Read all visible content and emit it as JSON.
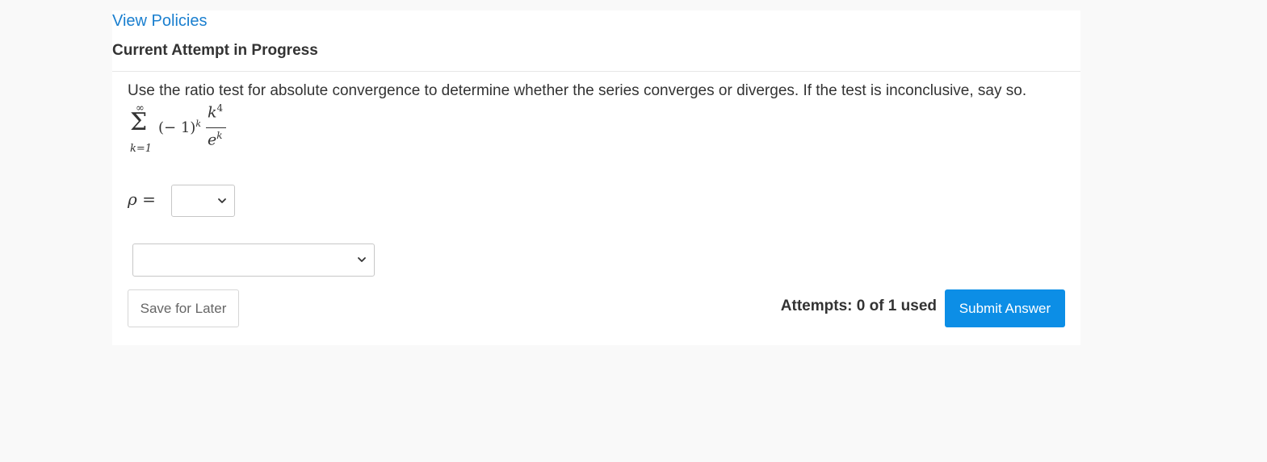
{
  "header": {
    "policies_link": "View Policies",
    "attempt_title": "Current Attempt in Progress"
  },
  "question": {
    "text": "Use the ratio test for absolute convergence to determine whether the series converges or diverges. If the test is inconclusive, say so.",
    "formula": {
      "sum_upper": "∞",
      "sum_symbol": "Σ",
      "sum_lower": "k=1",
      "term": "(− 1)",
      "term_exponent": "k",
      "numerator_base": "k",
      "numerator_exponent": "4",
      "denominator_base": "e",
      "denominator_exponent": "k"
    }
  },
  "answer": {
    "rho_symbol": "ρ",
    "equals": "=",
    "rho_select_value": "",
    "conclusion_select_value": ""
  },
  "footer": {
    "save_label": "Save for Later",
    "attempts_text": "Attempts: 0 of 1 used",
    "submit_label": "Submit Answer"
  },
  "colors": {
    "link": "#1a7fcf",
    "submit_bg": "#0c8ee6",
    "page_bg": "#f9f9f9"
  },
  "icons": [
    "chevron-down-icon"
  ]
}
